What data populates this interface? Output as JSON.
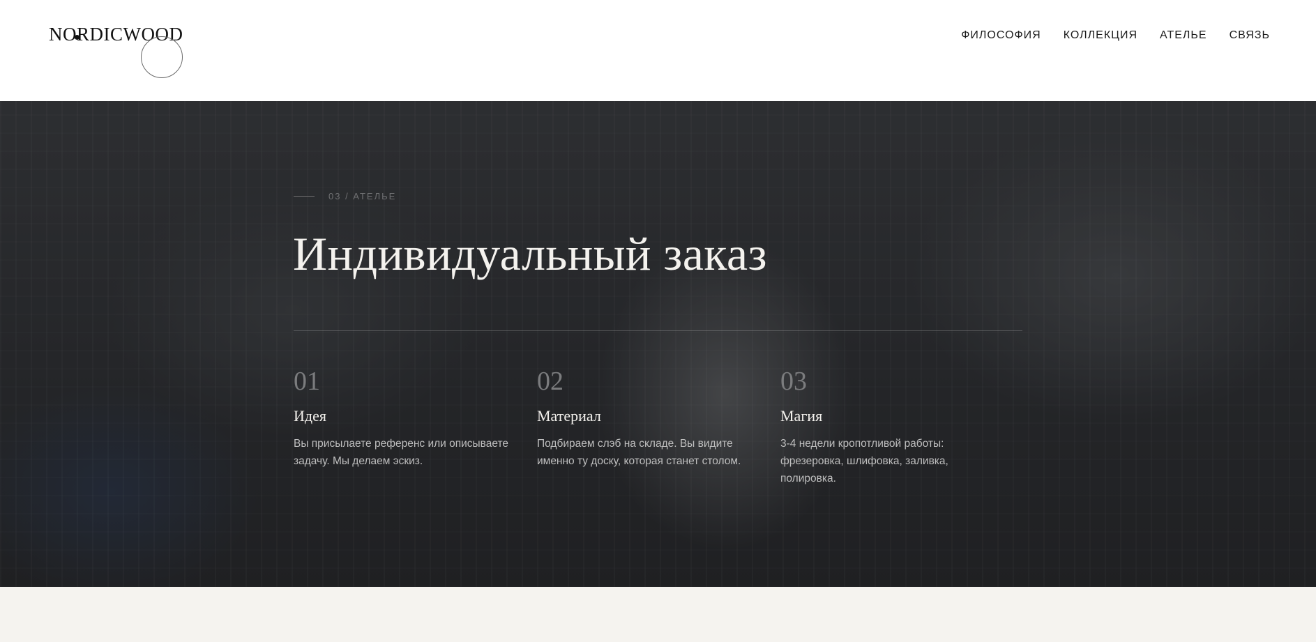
{
  "header": {
    "logo": "NORDICWOOD",
    "nav": [
      "ФИЛОСОФИЯ",
      "КОЛЛЕКЦИЯ",
      "АТЕЛЬЕ",
      "СВЯЗЬ"
    ]
  },
  "hero": {
    "eyebrow": "03 / АТЕЛЬЕ",
    "title": "Индивидуальный заказ",
    "steps": [
      {
        "number": "01",
        "title": "Идея",
        "text": "Вы присылаете референс или описываете задачу. Мы делаем эскиз."
      },
      {
        "number": "02",
        "title": "Материал",
        "text": "Подбираем слэб на складе. Вы видите именно ту доску, которая станет столом."
      },
      {
        "number": "03",
        "title": "Магия",
        "text": "3-4 недели кропотливой работы: фрезеровка, шлифовка, заливка, полировка."
      }
    ]
  },
  "colors": {
    "header_bg": "#ffffff",
    "hero_title": "#f4f2ee",
    "step_number": "#7b7c7e",
    "footer_bg": "#f5f3ef"
  }
}
